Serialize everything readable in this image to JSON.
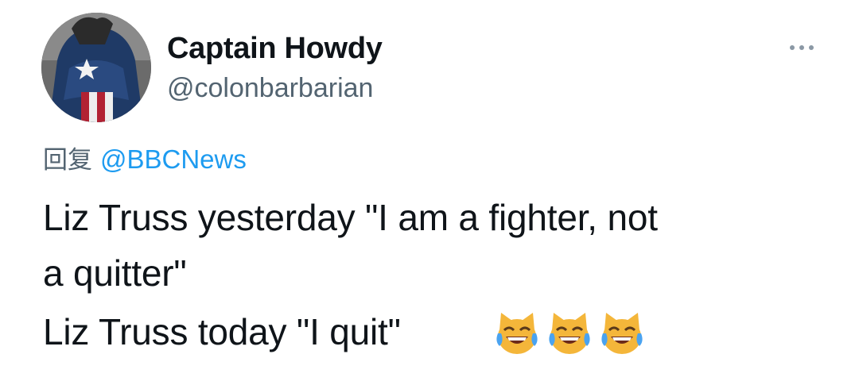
{
  "user": {
    "display_name": "Captain Howdy",
    "handle": "@colonbarbarian"
  },
  "reply": {
    "label": "回复",
    "mention": "@BBCNews"
  },
  "tweet": {
    "line1": "Liz Truss yesterday \"I am a fighter, not",
    "line2": "a quitter\"",
    "line3": "Liz Truss today \"I quit\""
  },
  "emoji": {
    "name": "cat-face-with-tears-of-joy",
    "count": 3
  },
  "icons": {
    "more": "more-options-icon"
  },
  "colors": {
    "mention_blue": "#1d9bf0",
    "secondary_gray": "#536471",
    "text": "#0f1419"
  }
}
